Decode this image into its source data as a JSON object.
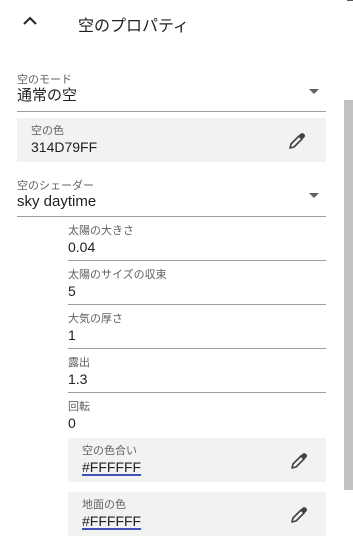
{
  "section": {
    "title": "空のプロパティ"
  },
  "sky_mode": {
    "label": "空のモード",
    "value": "通常の空"
  },
  "sky_color": {
    "label": "空の色",
    "value": "314D79FF"
  },
  "sky_shader": {
    "label": "空のシェーダー",
    "value": "sky daytime"
  },
  "shader_props": [
    {
      "label": "太陽の大きさ",
      "value": "0.04"
    },
    {
      "label": "太陽のサイズの収束",
      "value": "5"
    },
    {
      "label": "大気の厚さ",
      "value": "1"
    },
    {
      "label": "露出",
      "value": "1.3"
    },
    {
      "label": "回転",
      "value": "0"
    }
  ],
  "sky_tint": {
    "label": "空の色合い",
    "value": "#FFFFFF"
  },
  "ground_color": {
    "label": "地面の色",
    "value": "#FFFFFF"
  },
  "icons": {
    "collapse": "chevron-up-icon",
    "dropdown": "caret-down-icon",
    "picker": "eyedropper-icon"
  }
}
